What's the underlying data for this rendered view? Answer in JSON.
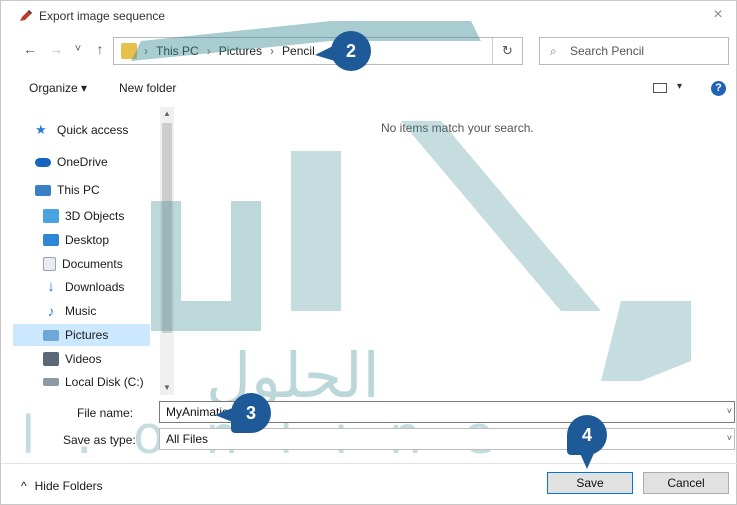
{
  "window": {
    "title": "Export image sequence",
    "close_glyph": "×"
  },
  "address": {
    "back_glyph": "←",
    "forward_glyph": "→",
    "recent_glyph": "˅",
    "up_glyph": "↑",
    "crumbs": [
      "This PC",
      "Pictures",
      "Pencil"
    ],
    "separator": "›",
    "dropdown_glyph": "˅",
    "refresh_glyph": "↻"
  },
  "search": {
    "placeholder": "Search Pencil",
    "icon_glyph": "⌕"
  },
  "toolbar": {
    "organize_label": "Organize ▾",
    "new_folder_label": "New folder",
    "view_dropdown_glyph": "▾",
    "help_glyph": "?"
  },
  "nav": {
    "items": [
      {
        "label": "Quick access",
        "icon": "star-icon",
        "color": "#2b7cd3"
      },
      {
        "label": "OneDrive",
        "icon": "cloud-icon",
        "color": "#1565c0"
      },
      {
        "label": "This PC",
        "icon": "computer-icon",
        "color": "#3b7fc4"
      },
      {
        "label": "3D Objects",
        "icon": "cube-icon",
        "color": "#4aa3df"
      },
      {
        "label": "Desktop",
        "icon": "desktop-icon",
        "color": "#2f86d8"
      },
      {
        "label": "Documents",
        "icon": "document-icon",
        "color": "#9aa3ad"
      },
      {
        "label": "Downloads",
        "icon": "download-icon",
        "color": "#2a6fd6"
      },
      {
        "label": "Music",
        "icon": "music-icon",
        "color": "#2f86d8"
      },
      {
        "label": "Pictures",
        "icon": "pictures-icon",
        "color": "#6fa6d8"
      },
      {
        "label": "Videos",
        "icon": "video-icon",
        "color": "#5a6878"
      },
      {
        "label": "Local Disk (C:)",
        "icon": "disk-icon",
        "color": "#8d99a6"
      }
    ],
    "selected": "Pictures"
  },
  "content": {
    "empty_message": "No items match your search."
  },
  "form": {
    "file_name_label": "File name:",
    "file_name_value": "MyAnimation",
    "save_type_label": "Save as type:",
    "save_type_value": "All Files",
    "dropdown_glyph": "˅"
  },
  "footer": {
    "hide_folders_glyph": "^",
    "hide_folders_label": "Hide Folders",
    "save_label": "Save",
    "cancel_label": "Cancel"
  },
  "callouts": [
    "2",
    "3",
    "4"
  ],
  "watermark": {
    "text": "l . o n l i n e",
    "arabic": "الحلول",
    "color": "#3e8e96"
  },
  "colors": {
    "callout": "#1e5a97",
    "selection": "#cce8ff",
    "accent": "#0078d7"
  }
}
